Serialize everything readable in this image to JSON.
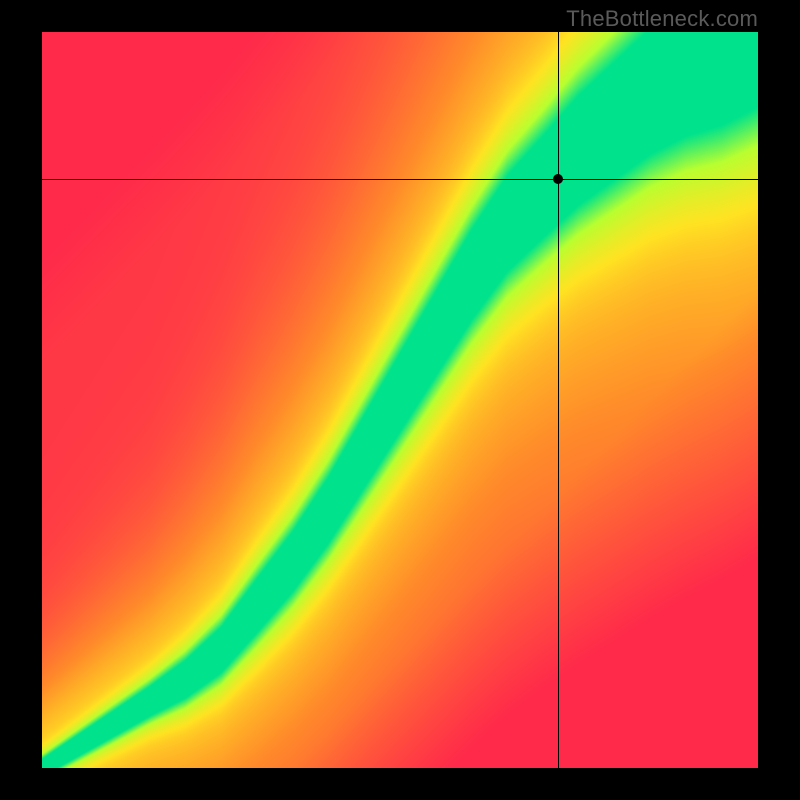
{
  "watermark_text": "TheBottleneck.com",
  "chart_data": {
    "type": "heatmap",
    "title": "",
    "xlabel": "",
    "ylabel": "",
    "xlim": [
      0,
      1
    ],
    "ylim": [
      0,
      1
    ],
    "color_scale": [
      {
        "t": 0.0,
        "color": "#ff2a4a"
      },
      {
        "t": 0.35,
        "color": "#ff8a2a"
      },
      {
        "t": 0.6,
        "color": "#ffe322"
      },
      {
        "t": 0.82,
        "color": "#b8ff30"
      },
      {
        "t": 1.0,
        "color": "#00e38c"
      }
    ],
    "ridge": [
      {
        "x": 0.0,
        "y": 0.0
      },
      {
        "x": 0.05,
        "y": 0.03
      },
      {
        "x": 0.1,
        "y": 0.06
      },
      {
        "x": 0.15,
        "y": 0.09
      },
      {
        "x": 0.2,
        "y": 0.12
      },
      {
        "x": 0.25,
        "y": 0.16
      },
      {
        "x": 0.3,
        "y": 0.22
      },
      {
        "x": 0.35,
        "y": 0.28
      },
      {
        "x": 0.4,
        "y": 0.35
      },
      {
        "x": 0.45,
        "y": 0.43
      },
      {
        "x": 0.5,
        "y": 0.51
      },
      {
        "x": 0.55,
        "y": 0.59
      },
      {
        "x": 0.6,
        "y": 0.67
      },
      {
        "x": 0.65,
        "y": 0.74
      },
      {
        "x": 0.7,
        "y": 0.79
      },
      {
        "x": 0.75,
        "y": 0.84
      },
      {
        "x": 0.8,
        "y": 0.88
      },
      {
        "x": 0.85,
        "y": 0.92
      },
      {
        "x": 0.9,
        "y": 0.95
      },
      {
        "x": 0.95,
        "y": 0.97
      },
      {
        "x": 1.0,
        "y": 1.0
      }
    ],
    "ridge_width": [
      {
        "x": 0.0,
        "w": 0.01
      },
      {
        "x": 0.15,
        "w": 0.02
      },
      {
        "x": 0.3,
        "w": 0.04
      },
      {
        "x": 0.5,
        "w": 0.06
      },
      {
        "x": 0.7,
        "w": 0.08
      },
      {
        "x": 0.85,
        "w": 0.1
      },
      {
        "x": 1.0,
        "w": 0.12
      }
    ],
    "marker": {
      "x": 0.72,
      "y": 0.8
    },
    "crosshair": {
      "x": 0.72,
      "y": 0.8
    }
  }
}
